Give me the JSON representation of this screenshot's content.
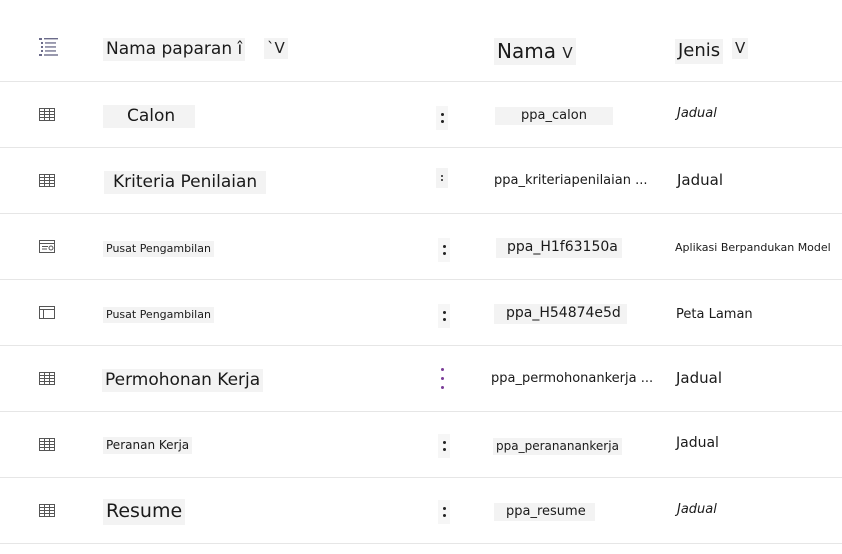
{
  "header": {
    "col_name": "Nama paparan",
    "col_name_sort_mark": "î",
    "col_name_chevron": "`V",
    "col_schema": "Nama",
    "col_schema_chevron": "V",
    "col_type": "Jenis",
    "col_type_chevron": "V"
  },
  "rows": [
    {
      "icon": "table-icon",
      "name": "Calon",
      "schema": "ppa_calon",
      "type": "Jadual"
    },
    {
      "icon": "table-icon",
      "name": "Kriteria Penilaian",
      "schema": "ppa_kriteriapenilaian ...",
      "type": "Jadual"
    },
    {
      "icon": "model-driven-app-icon",
      "name": "Pusat Pengambilan",
      "schema": "ppa_H1f63150a",
      "type": "Aplikasi Berpandukan Model"
    },
    {
      "icon": "sitemap-icon",
      "name": "Pusat Pengambilan",
      "schema": "ppa_H54874e5d",
      "type": "Peta Laman"
    },
    {
      "icon": "table-icon",
      "name": "Permohonan Kerja",
      "schema": "ppa_permohonankerja ...",
      "type": "Jadual"
    },
    {
      "icon": "table-icon",
      "name": "Peranan Kerja",
      "schema": "ppa_perananankerja",
      "type": "Jadual"
    },
    {
      "icon": "table-icon",
      "name": "Resume",
      "schema": "ppa_resume",
      "type": "Jadual"
    }
  ],
  "colors": {
    "accent_more": "#7a3d98",
    "divider": "#e6e6e6",
    "chip_bg": "#f3f3f3"
  }
}
